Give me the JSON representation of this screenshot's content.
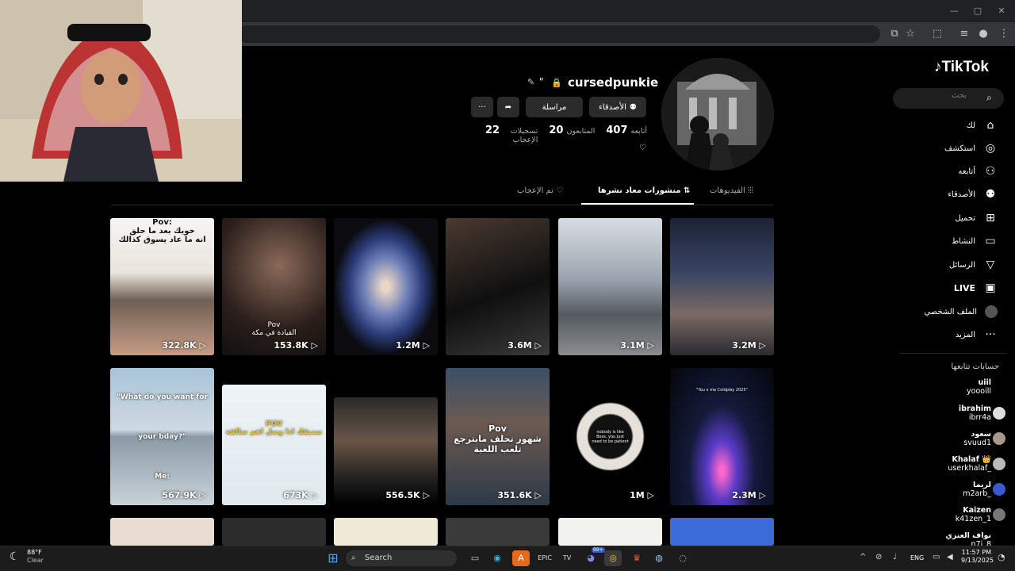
{
  "browser": {
    "window_controls": [
      "—",
      "▢",
      "✕"
    ]
  },
  "sidebar": {
    "logo": "TikTok",
    "search_placeholder": "بحث",
    "nav": [
      {
        "label": "لك",
        "icon": "home-icon"
      },
      {
        "label": "استكشف",
        "icon": "compass-icon"
      },
      {
        "label": "أتابعه",
        "icon": "user-follow-icon"
      },
      {
        "label": "الأصدقاء",
        "icon": "friends-icon"
      },
      {
        "label": "تحميل",
        "icon": "upload-icon"
      },
      {
        "label": "النشاط",
        "icon": "activity-icon"
      },
      {
        "label": "الرسائل",
        "icon": "messages-icon"
      },
      {
        "label": "LIVE",
        "icon": "live-icon"
      },
      {
        "label": "الملف الشخصي",
        "icon": "profile-icon"
      },
      {
        "label": "المزيد",
        "icon": "more-icon"
      }
    ],
    "following_title": "حسابات تتابعها",
    "following": [
      {
        "name": "uiil",
        "handle": "yoooill"
      },
      {
        "name": "ibrahim",
        "handle": "ibrr4a"
      },
      {
        "name": "سعود",
        "handle": "svuud1"
      },
      {
        "name": "Khalaf 👑",
        "handle": "userkhalaf_"
      },
      {
        "name": "لريما",
        "handle": "m2arb_"
      },
      {
        "name": "Kaizen",
        "handle": "k41zen_1"
      },
      {
        "name": "نواف العنزي",
        "handle": "n7i_8"
      }
    ]
  },
  "profile": {
    "username": "cursedpunkie",
    "extra": "\"",
    "buttons": {
      "friends": "الأصدقاء",
      "message": "مراسلة"
    },
    "stats": [
      {
        "value": "407",
        "label": "أتابعه"
      },
      {
        "value": "20",
        "label": "المتابعون"
      },
      {
        "value": "22",
        "label": "تسجيلات الإعجاب"
      }
    ],
    "bio": "♡"
  },
  "tabs": [
    {
      "label": "الفيديوهات",
      "icon": "grid-icon"
    },
    {
      "label": "منشورات معاد نشرها",
      "icon": "repost-icon"
    },
    {
      "label": "تم الإعجاب",
      "icon": "heart-off-icon"
    }
  ],
  "videos": [
    {
      "views": "322.8K",
      "caption": "Pov:\nخويك بعد ما حلق\nانه ما عاد يسوق كذالك"
    },
    {
      "views": "153.8K",
      "caption": "Pov\nالقيادة في مكة"
    },
    {
      "views": "1.2M",
      "caption": ""
    },
    {
      "views": "3.6M",
      "caption": ""
    },
    {
      "views": "3.1M",
      "caption": ""
    },
    {
      "views": "3.2M",
      "caption": ""
    },
    {
      "views": "567.9K",
      "caption": "\"What do you want for your bday?\"\nMe:"
    },
    {
      "views": "673K",
      "caption": "POV\nصديقك اذا وصل اهم سالفة"
    },
    {
      "views": "556.5K",
      "caption": ""
    },
    {
      "views": "351.6K",
      "caption": "Pov\nشهور تحلف مابترجع تلعب اللعبة"
    },
    {
      "views": "1M",
      "caption": "nobody is like Boss, you just need to be patient"
    },
    {
      "views": "2.3M",
      "caption": "\"You x me Coldplay 2025\""
    }
  ],
  "taskbar": {
    "weather_temp": "88°F",
    "weather_desc": "Clear",
    "search": "Search",
    "lang": "ENG",
    "time": "11:57 PM",
    "date": "9/13/2025",
    "badge": "99+"
  }
}
